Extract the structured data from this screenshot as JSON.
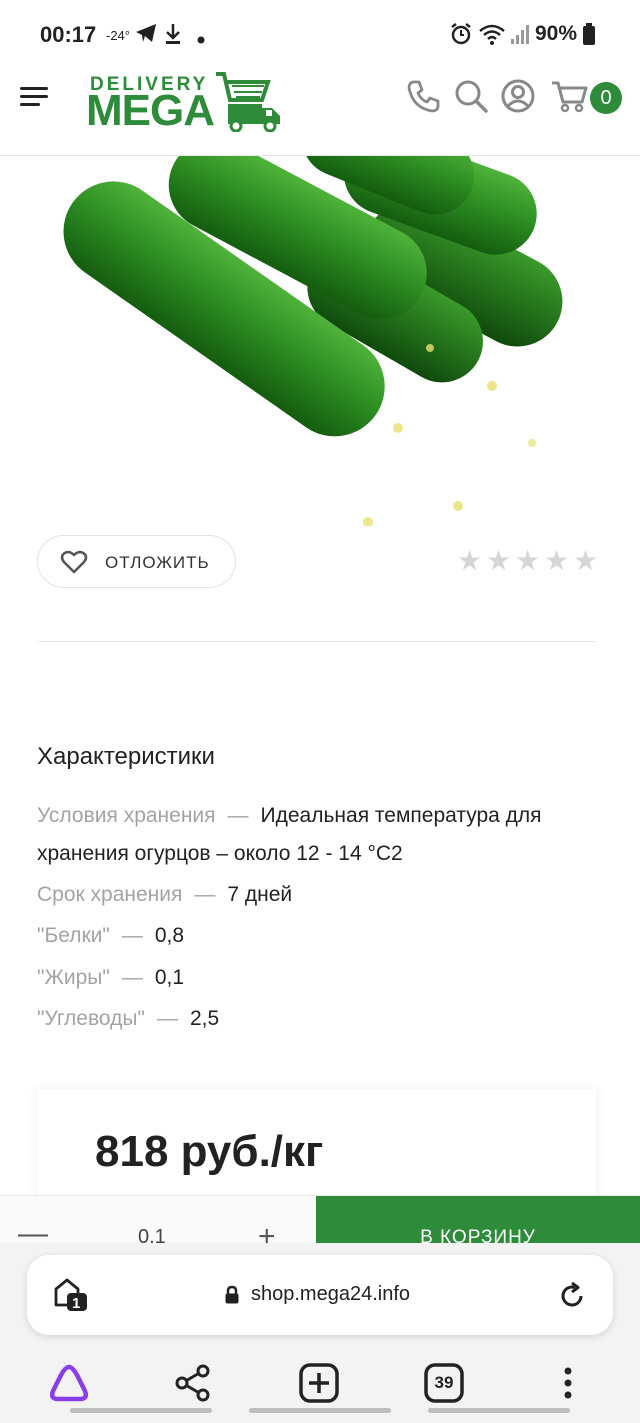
{
  "status_bar": {
    "time": "00:17",
    "temperature": "-24°",
    "battery": "90%"
  },
  "header": {
    "logo_top": "DELIVERY",
    "logo_main": "MEGA",
    "cart_count": "0"
  },
  "product": {
    "image_alt": "cucumbers",
    "defer_label": "ОТЛОЖИТЬ",
    "rating_stars": 0,
    "rating_max": 5
  },
  "characteristics": {
    "title": "Характеристики",
    "rows": [
      {
        "key": "Условия хранения",
        "dash": "—",
        "value": "Идеальная температура для хранения огурцов – около 12 - 14 °С2"
      },
      {
        "key": "Срок хранения",
        "dash": "—",
        "value": "7 дней"
      },
      {
        "key": "\"Белки\"",
        "dash": "—",
        "value": "0,8"
      },
      {
        "key": "\"Жиры\"",
        "dash": "—",
        "value": "0,1"
      },
      {
        "key": "\"Углеводы\"",
        "dash": "—",
        "value": "2,5"
      }
    ]
  },
  "price": {
    "value": "818 руб./кг"
  },
  "buy_bar": {
    "minus": "—",
    "quantity": "0,1",
    "plus": "+",
    "add_to_cart": "В КОРЗИНУ"
  },
  "browser": {
    "url": "shop.mega24.info",
    "tab_group_count": "1",
    "tabs_count": "39"
  },
  "colors": {
    "brand_green": "#2e8b3a",
    "muted_text": "#a3a3a3",
    "star_empty": "#d6d6d6"
  }
}
